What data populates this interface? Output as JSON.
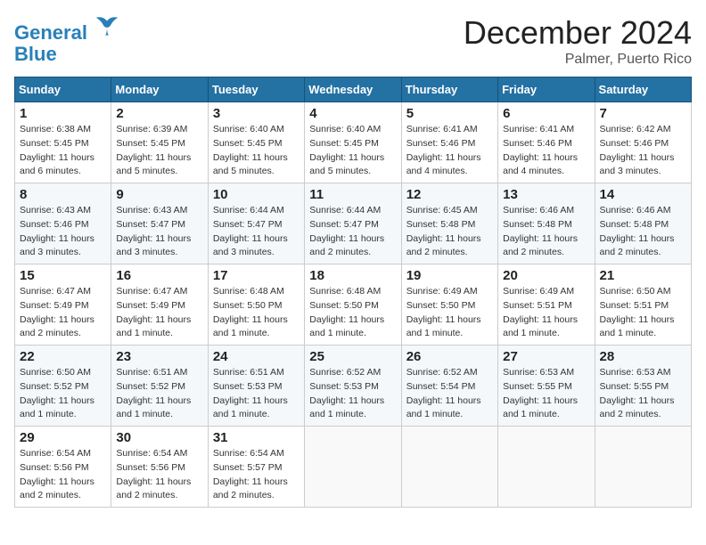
{
  "header": {
    "logo_line1": "General",
    "logo_line2": "Blue",
    "month": "December 2024",
    "location": "Palmer, Puerto Rico"
  },
  "days_of_week": [
    "Sunday",
    "Monday",
    "Tuesday",
    "Wednesday",
    "Thursday",
    "Friday",
    "Saturday"
  ],
  "weeks": [
    [
      {
        "day": "1",
        "sunrise": "6:38 AM",
        "sunset": "5:45 PM",
        "daylight": "11 hours and 6 minutes."
      },
      {
        "day": "2",
        "sunrise": "6:39 AM",
        "sunset": "5:45 PM",
        "daylight": "11 hours and 5 minutes."
      },
      {
        "day": "3",
        "sunrise": "6:40 AM",
        "sunset": "5:45 PM",
        "daylight": "11 hours and 5 minutes."
      },
      {
        "day": "4",
        "sunrise": "6:40 AM",
        "sunset": "5:45 PM",
        "daylight": "11 hours and 5 minutes."
      },
      {
        "day": "5",
        "sunrise": "6:41 AM",
        "sunset": "5:46 PM",
        "daylight": "11 hours and 4 minutes."
      },
      {
        "day": "6",
        "sunrise": "6:41 AM",
        "sunset": "5:46 PM",
        "daylight": "11 hours and 4 minutes."
      },
      {
        "day": "7",
        "sunrise": "6:42 AM",
        "sunset": "5:46 PM",
        "daylight": "11 hours and 3 minutes."
      }
    ],
    [
      {
        "day": "8",
        "sunrise": "6:43 AM",
        "sunset": "5:46 PM",
        "daylight": "11 hours and 3 minutes."
      },
      {
        "day": "9",
        "sunrise": "6:43 AM",
        "sunset": "5:47 PM",
        "daylight": "11 hours and 3 minutes."
      },
      {
        "day": "10",
        "sunrise": "6:44 AM",
        "sunset": "5:47 PM",
        "daylight": "11 hours and 3 minutes."
      },
      {
        "day": "11",
        "sunrise": "6:44 AM",
        "sunset": "5:47 PM",
        "daylight": "11 hours and 2 minutes."
      },
      {
        "day": "12",
        "sunrise": "6:45 AM",
        "sunset": "5:48 PM",
        "daylight": "11 hours and 2 minutes."
      },
      {
        "day": "13",
        "sunrise": "6:46 AM",
        "sunset": "5:48 PM",
        "daylight": "11 hours and 2 minutes."
      },
      {
        "day": "14",
        "sunrise": "6:46 AM",
        "sunset": "5:48 PM",
        "daylight": "11 hours and 2 minutes."
      }
    ],
    [
      {
        "day": "15",
        "sunrise": "6:47 AM",
        "sunset": "5:49 PM",
        "daylight": "11 hours and 2 minutes."
      },
      {
        "day": "16",
        "sunrise": "6:47 AM",
        "sunset": "5:49 PM",
        "daylight": "11 hours and 1 minute."
      },
      {
        "day": "17",
        "sunrise": "6:48 AM",
        "sunset": "5:50 PM",
        "daylight": "11 hours and 1 minute."
      },
      {
        "day": "18",
        "sunrise": "6:48 AM",
        "sunset": "5:50 PM",
        "daylight": "11 hours and 1 minute."
      },
      {
        "day": "19",
        "sunrise": "6:49 AM",
        "sunset": "5:50 PM",
        "daylight": "11 hours and 1 minute."
      },
      {
        "day": "20",
        "sunrise": "6:49 AM",
        "sunset": "5:51 PM",
        "daylight": "11 hours and 1 minute."
      },
      {
        "day": "21",
        "sunrise": "6:50 AM",
        "sunset": "5:51 PM",
        "daylight": "11 hours and 1 minute."
      }
    ],
    [
      {
        "day": "22",
        "sunrise": "6:50 AM",
        "sunset": "5:52 PM",
        "daylight": "11 hours and 1 minute."
      },
      {
        "day": "23",
        "sunrise": "6:51 AM",
        "sunset": "5:52 PM",
        "daylight": "11 hours and 1 minute."
      },
      {
        "day": "24",
        "sunrise": "6:51 AM",
        "sunset": "5:53 PM",
        "daylight": "11 hours and 1 minute."
      },
      {
        "day": "25",
        "sunrise": "6:52 AM",
        "sunset": "5:53 PM",
        "daylight": "11 hours and 1 minute."
      },
      {
        "day": "26",
        "sunrise": "6:52 AM",
        "sunset": "5:54 PM",
        "daylight": "11 hours and 1 minute."
      },
      {
        "day": "27",
        "sunrise": "6:53 AM",
        "sunset": "5:55 PM",
        "daylight": "11 hours and 1 minute."
      },
      {
        "day": "28",
        "sunrise": "6:53 AM",
        "sunset": "5:55 PM",
        "daylight": "11 hours and 2 minutes."
      }
    ],
    [
      {
        "day": "29",
        "sunrise": "6:54 AM",
        "sunset": "5:56 PM",
        "daylight": "11 hours and 2 minutes."
      },
      {
        "day": "30",
        "sunrise": "6:54 AM",
        "sunset": "5:56 PM",
        "daylight": "11 hours and 2 minutes."
      },
      {
        "day": "31",
        "sunrise": "6:54 AM",
        "sunset": "5:57 PM",
        "daylight": "11 hours and 2 minutes."
      },
      null,
      null,
      null,
      null
    ]
  ]
}
